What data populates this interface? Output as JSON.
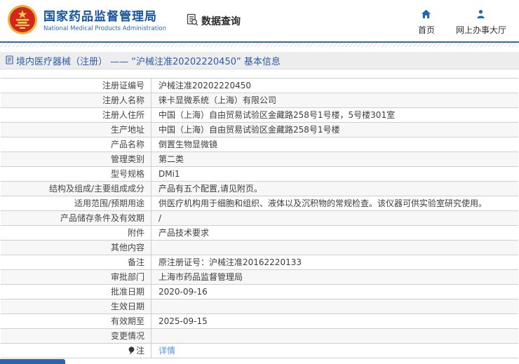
{
  "header": {
    "brand": {
      "title": "国家药品监督管理局",
      "subtitle": "National Medical Products Administration"
    },
    "nav": {
      "data_query": "数据查询",
      "home": "首页",
      "online_hall": "网上办事大厅"
    }
  },
  "breadcrumb": {
    "text": "境内医疗器械（注册） ——  “沪械注准20202220450” 基本信息"
  },
  "table": {
    "rows": [
      {
        "label": "注册证编号",
        "value": "沪械注准20202220450"
      },
      {
        "label": "注册人名称",
        "value": "徕卡显微系统（上海）有限公司"
      },
      {
        "label": "注册人住所",
        "value": "中国（上海）自由贸易试验区金藏路258号1号楼，5号楼301室"
      },
      {
        "label": "生产地址",
        "value": "中国（上海）自由贸易试验区金藏路258号1号楼"
      },
      {
        "label": "产品名称",
        "value": "倒置生物显微镜"
      },
      {
        "label": "管理类别",
        "value": "第二类"
      },
      {
        "label": "型号规格",
        "value": "DMi1"
      },
      {
        "label": "结构及组成/主要组成成分",
        "value": "产品有五个配置,请见附页。"
      },
      {
        "label": "适用范围/预期用途",
        "value": "供医疗机构用于细胞和组织、液体以及沉积物的常规检查。该仪器可供实验室研究使用。"
      },
      {
        "label": "产品储存条件及有效期",
        "value": "/"
      },
      {
        "label": "附件",
        "value": "产品技术要求"
      },
      {
        "label": "其他内容",
        "value": ""
      },
      {
        "label": "备注",
        "value": "原注册证号：沪械注准20162220133"
      },
      {
        "label": "审批部门",
        "value": "上海市药品监督管理局"
      },
      {
        "label": "批准日期",
        "value": "2020-09-16"
      },
      {
        "label": "生效日期",
        "value": ""
      },
      {
        "label": "有效期至",
        "value": "2025-09-15"
      },
      {
        "label": "变更情况",
        "value": ""
      },
      {
        "label": "注",
        "value": "详情"
      }
    ]
  },
  "icons": {
    "emblem": "china-national-emblem",
    "data_query": "document-search-icon",
    "home": "home-icon",
    "online_hall": "person-icon",
    "breadcrumb": "document-icon",
    "note": "balloon-note-icon"
  },
  "colors": {
    "brand_blue": "#15549e",
    "accent_blue": "#2b6cb0",
    "breadcrumb_text": "#2a5caa",
    "link_blue": "#4f94e0",
    "emblem_red": "#d0281c",
    "emblem_gold": "#e9b43c",
    "row_alt_bg": "#f7f7f7",
    "table_border": "#cfcfcf"
  }
}
